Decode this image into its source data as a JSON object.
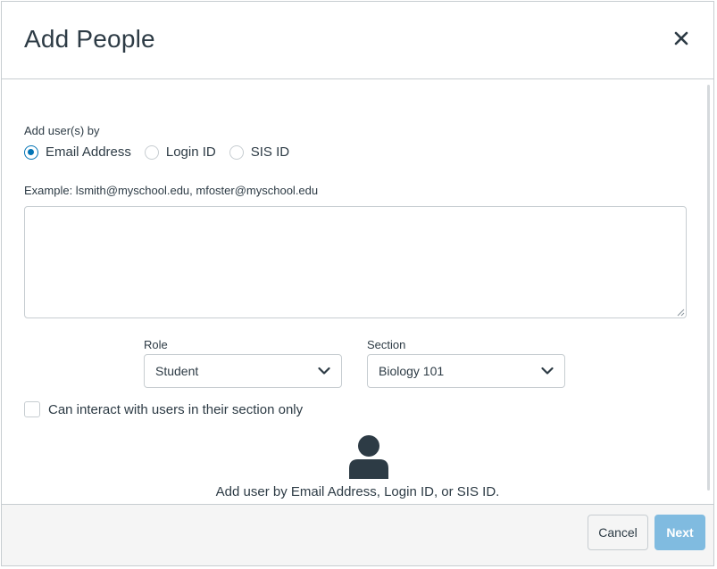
{
  "dialog": {
    "title": "Add People",
    "close_icon": "close-icon"
  },
  "form": {
    "add_by_label": "Add user(s) by",
    "options": [
      {
        "label": "Email Address",
        "checked": true
      },
      {
        "label": "Login ID",
        "checked": false
      },
      {
        "label": "SIS ID",
        "checked": false
      }
    ],
    "example_text": "Example: lsmith@myschool.edu, mfoster@myschool.edu",
    "textarea_value": "",
    "role": {
      "label": "Role",
      "value": "Student"
    },
    "section": {
      "label": "Section",
      "value": "Biology 101"
    },
    "limit_checkbox": {
      "label": "Can interact with users in their section only",
      "checked": false
    },
    "hint_icon": "user-icon",
    "hint": "Add user by Email Address, Login ID, or SIS ID."
  },
  "footer": {
    "cancel_label": "Cancel",
    "next_label": "Next"
  },
  "colors": {
    "accent": "#0374b5",
    "next_disabled": "#80bbe0",
    "text": "#2d3b45",
    "border": "#c7cdd1"
  }
}
